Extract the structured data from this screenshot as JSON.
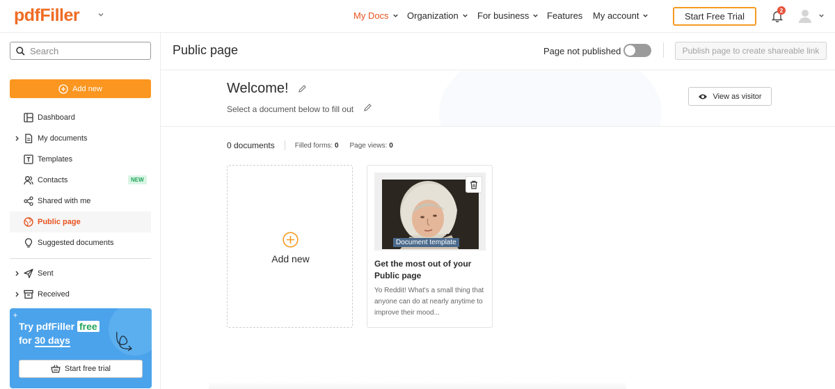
{
  "app": {
    "logo": "pdfFiller"
  },
  "topnav": {
    "items": [
      {
        "label": "My Docs",
        "active": true
      },
      {
        "label": "Organization"
      },
      {
        "label": "For business"
      },
      {
        "label": "Features"
      },
      {
        "label": "My account"
      }
    ],
    "trial_button": "Start Free Trial",
    "notifications_count": "2"
  },
  "sidebar": {
    "search_placeholder": "Search",
    "add_new": "Add new",
    "items": [
      {
        "label": "Dashboard",
        "icon": "dashboard-icon"
      },
      {
        "label": "My documents",
        "icon": "document-icon",
        "expandable": true
      },
      {
        "label": "Templates",
        "icon": "templates-icon"
      },
      {
        "label": "Contacts",
        "icon": "contacts-icon",
        "badge": "NEW"
      },
      {
        "label": "Shared with me",
        "icon": "share-icon"
      },
      {
        "label": "Public page",
        "icon": "public-page-icon",
        "active": true
      },
      {
        "label": "Suggested documents",
        "icon": "lightbulb-icon"
      },
      {
        "label": "Sent",
        "icon": "send-icon",
        "expandable": true
      },
      {
        "label": "Received",
        "icon": "inbox-icon",
        "expandable": true
      }
    ],
    "promo": {
      "line1_prefix": "Try pdfFiller",
      "line1_highlight": "free",
      "line2_prefix": "for",
      "line2_highlight": "30 days",
      "button": "Start free trial"
    }
  },
  "header": {
    "title": "Public page",
    "publish_status": "Page not published",
    "publish_button": "Publish page to create shareable link"
  },
  "welcome": {
    "title": "Welcome!",
    "subtitle": "Select a document below to fill out",
    "view_button": "View as visitor"
  },
  "stats": {
    "documents": "0 documents",
    "filled_label": "Filled forms:",
    "filled_value": "0",
    "views_label": "Page views:",
    "views_value": "0"
  },
  "cards": {
    "add_new": "Add new",
    "doc": {
      "tag": "Document template",
      "title": "Get the most out of your Public page",
      "description": "Yo Reddit! What's a small thing that anyone can do at nearly anytime to improve their mood..."
    }
  },
  "colors": {
    "brand": "#ef6c24",
    "accent": "#fb9620",
    "promo": "#4ba3ec"
  }
}
